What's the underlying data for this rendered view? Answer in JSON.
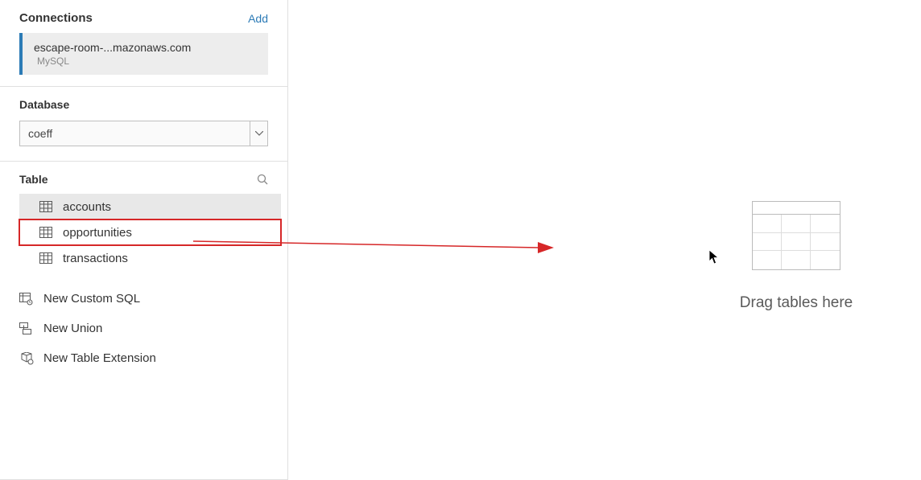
{
  "sidebar": {
    "connections": {
      "title": "Connections",
      "add_label": "Add",
      "items": [
        {
          "name": "escape-room-...mazonaws.com",
          "type": "MySQL"
        }
      ]
    },
    "database": {
      "title": "Database",
      "selected": "coeff"
    },
    "table": {
      "title": "Table",
      "items": [
        {
          "name": "accounts"
        },
        {
          "name": "opportunities"
        },
        {
          "name": "transactions"
        }
      ],
      "actions": {
        "custom_sql": "New Custom SQL",
        "union": "New Union",
        "table_extension": "New Table Extension"
      }
    }
  },
  "canvas": {
    "drop_text": "Drag tables here"
  }
}
